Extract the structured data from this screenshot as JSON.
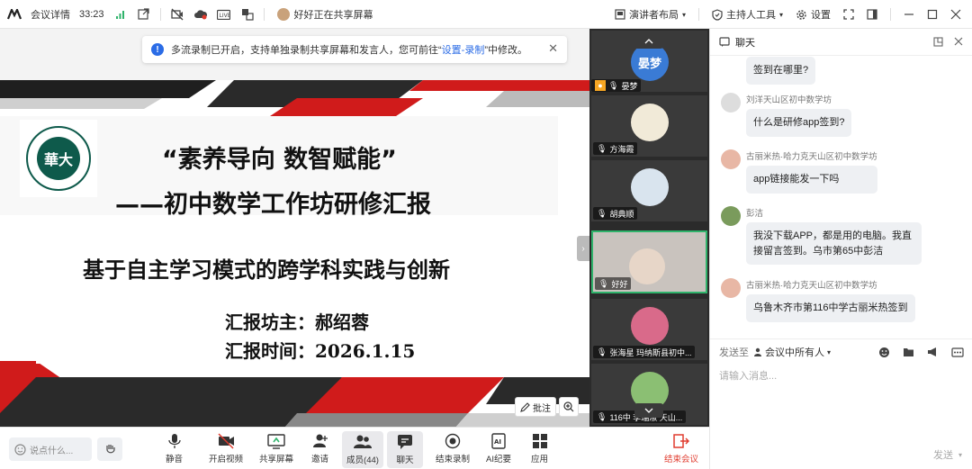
{
  "topbar": {
    "meeting_info": "会议详情",
    "timer": "33:23",
    "sharing_text": "好好正在共享屏幕",
    "speaker_layout": "演讲者布局",
    "host_tools": "主持人工具",
    "settings": "设置"
  },
  "banner": {
    "text_pre": "多流录制已开启，支持单独录制共享屏幕和发言人，您可前往“",
    "link": "设置-录制",
    "text_post": "”中修改。"
  },
  "slide": {
    "title1": "“素养导向 数智赋能”",
    "title2": "——初中数学工作坊研修汇报",
    "subtitle": "基于自主学习模式的跨学科实践与创新",
    "presenter_label": "汇报坊主：",
    "presenter": "郝绍蓉",
    "date_label": "汇报时间：",
    "date": "2026.1.15",
    "logo_text": "華大",
    "annotate": "批注"
  },
  "participants": [
    {
      "name": "晏梦",
      "avatar_text": "晏梦",
      "color": "#3a7bd5"
    },
    {
      "name": "方海霞"
    },
    {
      "name": "胡典顺"
    },
    {
      "name": "好好"
    },
    {
      "name": "张海星  玛纳斯县初中..."
    },
    {
      "name": "116中  李瑞淑  天山..."
    }
  ],
  "chat": {
    "title": "聊天",
    "messages": [
      {
        "name": "",
        "text": "签到在哪里?"
      },
      {
        "name": "刘洋天山区初中数学坊",
        "text": "什么是研修app签到?"
      },
      {
        "name": "古丽米热·哈力克天山区初中数学坊",
        "text": "app链接能发一下吗"
      },
      {
        "name": "彭洁",
        "text": "我没下载APP，都是用的电脑。我直接留言签到。乌市第65中彭洁"
      },
      {
        "name": "古丽米热·哈力克天山区初中数学坊",
        "text": "乌鲁木齐市第116中学古丽米热签到"
      }
    ],
    "send_to_label": "发送至",
    "send_to_target": "会议中所有人",
    "input_placeholder": "请输入消息...",
    "send_label": "发送"
  },
  "bottombar": {
    "say_placeholder": "说点什么...",
    "mute": "静音",
    "video": "开启视频",
    "share": "共享屏幕",
    "invite": "邀请",
    "members": "成员(44)",
    "chat": "聊天",
    "end_record": "结束录制",
    "ai_notes": "AI纪要",
    "apps": "应用",
    "end_meeting": "结束会议"
  }
}
